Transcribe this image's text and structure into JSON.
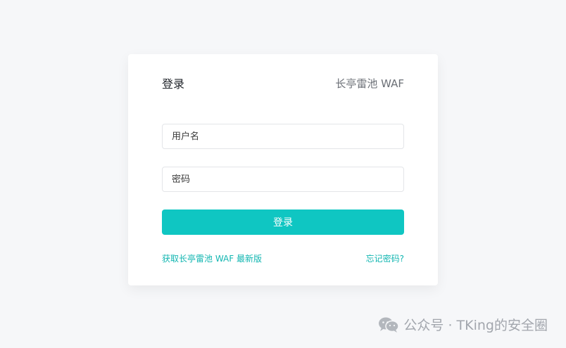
{
  "header": {
    "title": "登录",
    "brand": "长亭雷池 WAF"
  },
  "form": {
    "username_placeholder": "用户名",
    "password_placeholder": "密码",
    "submit_label": "登录"
  },
  "links": {
    "get_latest": "获取长亭雷池 WAF 最新版",
    "forgot_password": "忘记密码?"
  },
  "watermark": {
    "text": "公众号 · TKing的安全圈",
    "icon": "wechat-icon"
  },
  "colors": {
    "accent": "#0fc6c2",
    "link": "#12b6b1",
    "background": "#f6f7f9"
  }
}
